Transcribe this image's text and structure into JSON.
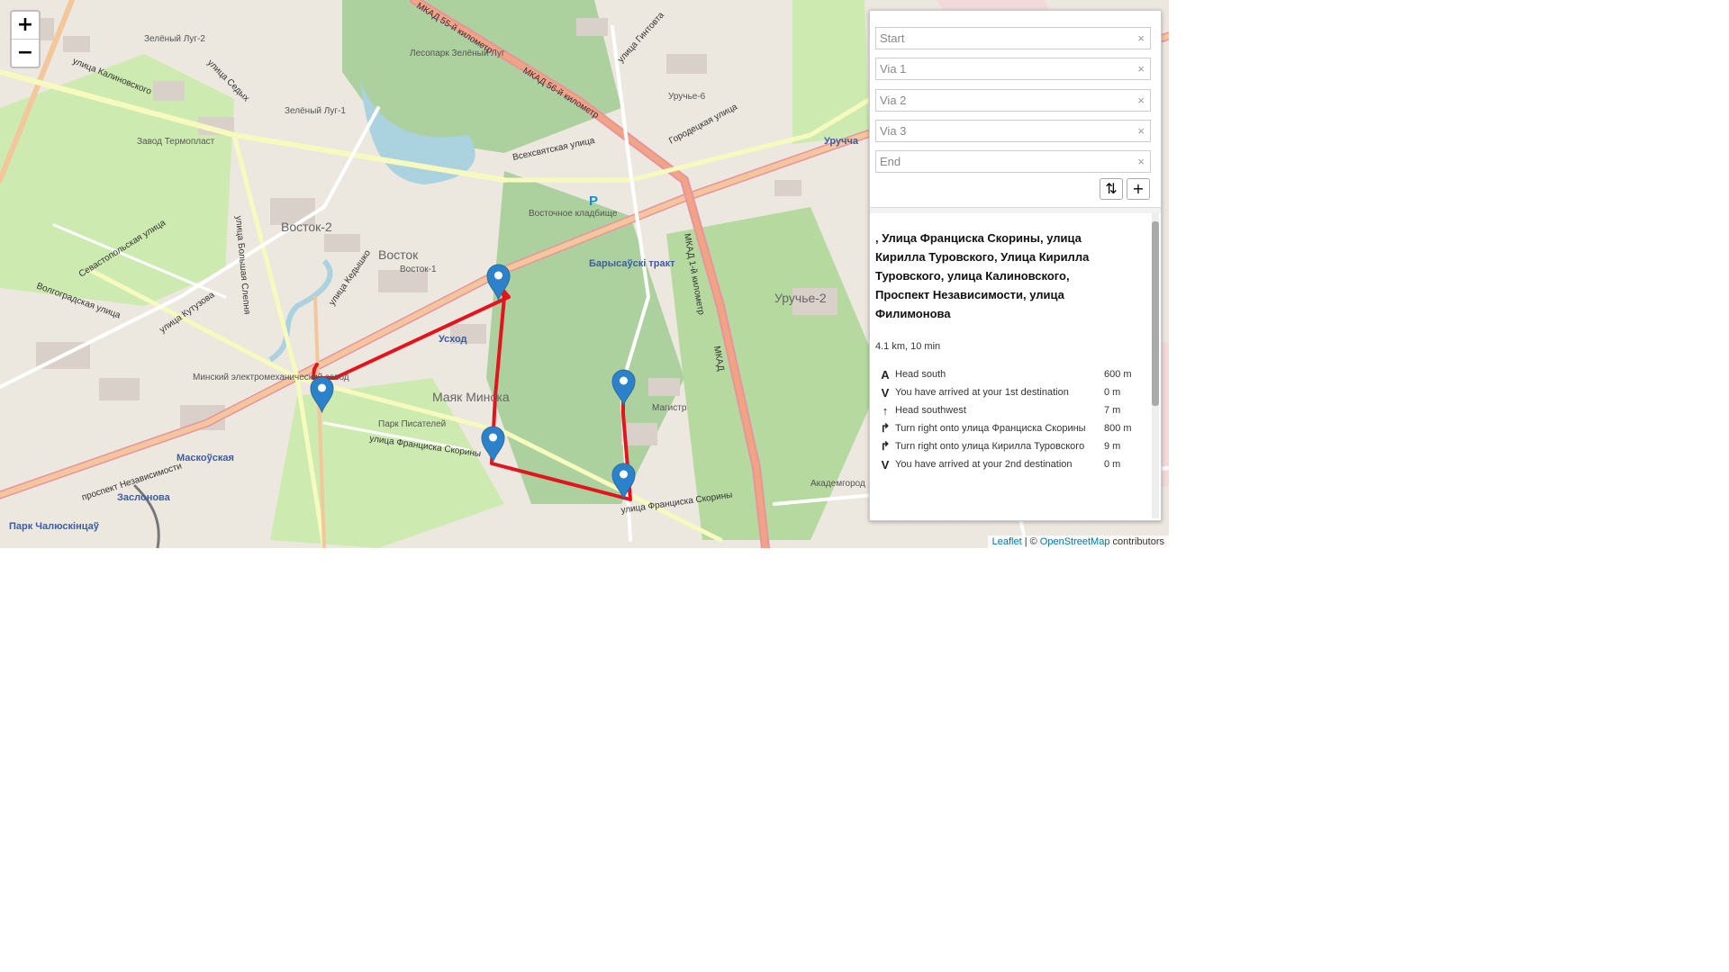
{
  "map": {
    "labels": {
      "zeleny_lug2": "Зелёный Луг-2",
      "lesopark": "Лесопарк Зелёный Луг",
      "zeleny_lug1": "Зелёный Луг-1",
      "termoplast": "Завод Термопласт",
      "vostok2": "Восток-2",
      "vostok": "Восток",
      "vostok1": "Восток-1",
      "vostochnoe": "Восточное кладбище",
      "barysauski": "Барысаўскі тракт",
      "uruchcha": "Уручча",
      "uruchye6": "Уручье-6",
      "uruchye2": "Уручье-2",
      "uskhod": "Усход",
      "mayak": "Маяк Минска",
      "park_pisateley": "Парк Писателей",
      "magistr": "Магистр",
      "akademgorod": "Академгород",
      "minsky_zavod": "Минский электромеханический завод",
      "maskouskaya": "Маскоўская",
      "zaslonova": "Заслонова",
      "park_chalyuskintsau": "Парк Чалюскінцаў",
      "skoriny": "улица Франциска Скорины",
      "skoriny2": "улица Франциска Скорины",
      "nezavisimosti": "проспект Независимости",
      "mkad55": "МКАД 55-й километр",
      "mkad56": "МКАД 56-й километр",
      "mkad1": "МКАД 1-й километр",
      "mkad": "МКАД",
      "vseksvyatskaya": "Всехсвятская улица",
      "gorodetskaya": "Городецкая улица",
      "gintovta": "улица Гинтовта",
      "kedyshko": "улица Кедышко",
      "kutuzova": "улица Кутузова",
      "sevastopolskaya": "Севастопольская улица",
      "volgogradskaya": "Волгоградская улица",
      "kalinovskogo": "улица Калиновского",
      "sedykh": "улица Седых",
      "bolshaya_slepnya": "улица Большая Слепня",
      "parking": "P"
    },
    "zoom_in": "+",
    "zoom_out": "−",
    "attribution": {
      "leaflet": "Leaflet",
      "sep": "| ©",
      "osm": "OpenStreetMap",
      "contrib": "contributors"
    },
    "route_color": "#e3141e",
    "marker_color": "#2b82cb"
  },
  "routing": {
    "waypoints": [
      {
        "placeholder": "Start",
        "value": ""
      },
      {
        "placeholder": "Via 1",
        "value": ""
      },
      {
        "placeholder": "Via 2",
        "value": ""
      },
      {
        "placeholder": "Via 3",
        "value": ""
      },
      {
        "placeholder": "End",
        "value": ""
      }
    ],
    "clear": "×",
    "reverse_icon": "⇅",
    "add_icon": "+",
    "route_name": ", Улица Франциска Скорины, улица Кирилла Туровского, Улица Кирилла Туровского, улица Калиновского, Проспект Независимости, улица Филимонова",
    "summary": "4.1 km, 10 min",
    "steps": [
      {
        "icon": "A",
        "icon_name": "depart-icon",
        "text": "Head south",
        "distance": "600 m"
      },
      {
        "icon": "V",
        "icon_name": "via-icon",
        "text": "You have arrived at your 1st destination",
        "distance": "0 m"
      },
      {
        "icon": "↑",
        "icon_name": "straight-icon",
        "text": "Head southwest",
        "distance": "7 m"
      },
      {
        "icon": "↱",
        "icon_name": "turn-right-icon",
        "text": "Turn right onto улица Франциска Скорины",
        "distance": "800 m"
      },
      {
        "icon": "↱",
        "icon_name": "turn-right-icon",
        "text": "Turn right onto улица Кирилла Туровского",
        "distance": "9 m"
      },
      {
        "icon": "V",
        "icon_name": "via-icon",
        "text": "You have arrived at your 2nd destination",
        "distance": "0 m"
      }
    ]
  }
}
